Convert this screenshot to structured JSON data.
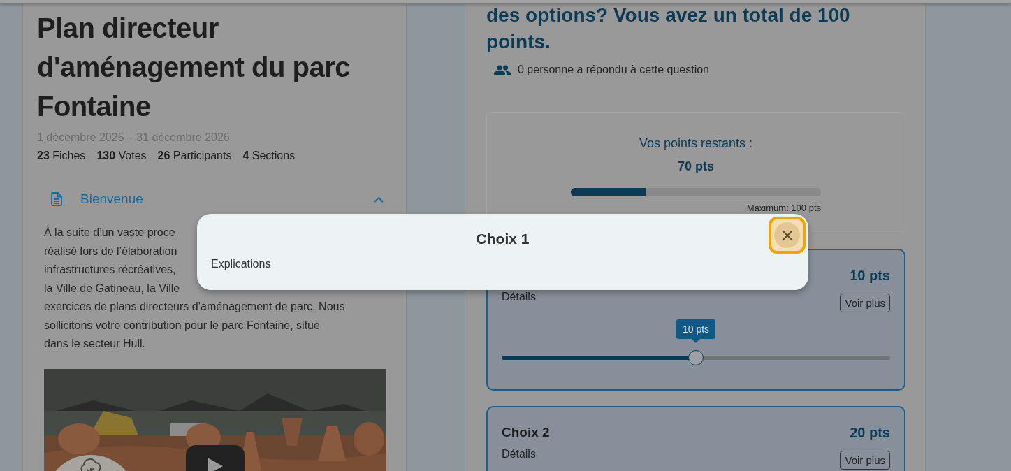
{
  "project": {
    "title": "Plan directeur d'aménagement du parc Fontaine",
    "dates": "1 décembre 2025 – 31 décembre 2026",
    "stats": [
      "**23** Fiches",
      "**130** Votes",
      "**26** Participants",
      "**4** Sections"
    ]
  },
  "section": {
    "title": "Bienvenue",
    "expanded": true,
    "lines": [
      " À la suite d’un vaste proce",
      "réalisé lors de l’élaboration",
      "infrastructures récréatives,",
      "la Ville de Gatineau, la Ville",
      "exercices de plans directeurs d’aménagement de parc. Nous",
      "sollicitons votre contribution pour le parc Fontaine, situé",
      "dans le secteur Hull."
    ]
  },
  "question": {
    "title_lines": [
      "des options? Vous avez un total de 100",
      "points."
    ],
    "respondents": "0 personne a répondu à cette question"
  },
  "budget": {
    "label": "Vos points restants :",
    "remaining": "70 pts",
    "level": 0.3,
    "maximum": "Maximum: 100 pts"
  },
  "choices": [
    {
      "points": "10 pts",
      "details": "Détails",
      "button": "Voir plus",
      "slider": {
        "level": 0.5,
        "tooltip": "10 pts"
      }
    },
    {
      "title": "Choix 2",
      "points": "20 pts",
      "details": "Détails",
      "button": "Voir plus"
    }
  ],
  "modal": {
    "title": "Choix 1",
    "body": "Explications"
  }
}
